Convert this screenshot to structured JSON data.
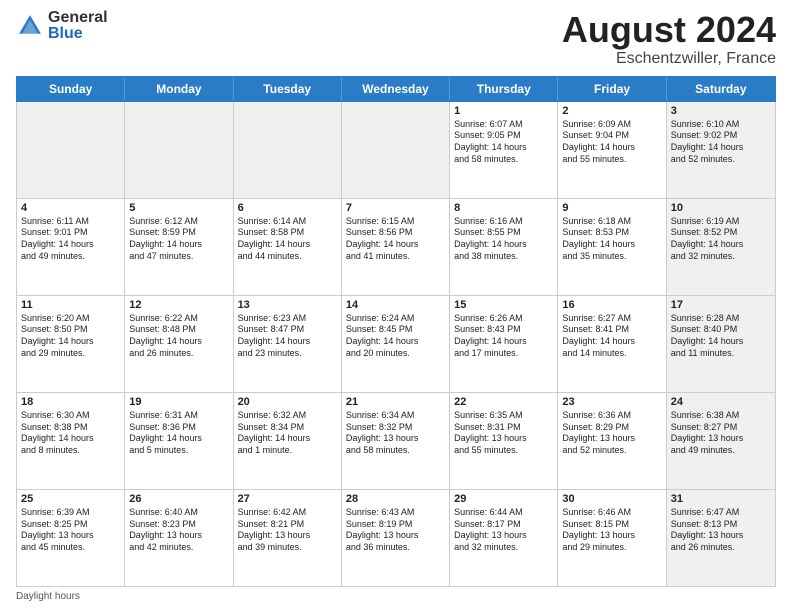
{
  "header": {
    "logo_general": "General",
    "logo_blue": "Blue",
    "title": "August 2024",
    "location": "Eschentzwiller, France"
  },
  "days_of_week": [
    "Sunday",
    "Monday",
    "Tuesday",
    "Wednesday",
    "Thursday",
    "Friday",
    "Saturday"
  ],
  "weeks": [
    [
      {
        "day": "",
        "info": "",
        "shaded": true
      },
      {
        "day": "",
        "info": "",
        "shaded": true
      },
      {
        "day": "",
        "info": "",
        "shaded": true
      },
      {
        "day": "",
        "info": "",
        "shaded": true
      },
      {
        "day": "1",
        "info": "Sunrise: 6:07 AM\nSunset: 9:05 PM\nDaylight: 14 hours\nand 58 minutes.",
        "shaded": false
      },
      {
        "day": "2",
        "info": "Sunrise: 6:09 AM\nSunset: 9:04 PM\nDaylight: 14 hours\nand 55 minutes.",
        "shaded": false
      },
      {
        "day": "3",
        "info": "Sunrise: 6:10 AM\nSunset: 9:02 PM\nDaylight: 14 hours\nand 52 minutes.",
        "shaded": true
      }
    ],
    [
      {
        "day": "4",
        "info": "Sunrise: 6:11 AM\nSunset: 9:01 PM\nDaylight: 14 hours\nand 49 minutes.",
        "shaded": false
      },
      {
        "day": "5",
        "info": "Sunrise: 6:12 AM\nSunset: 8:59 PM\nDaylight: 14 hours\nand 47 minutes.",
        "shaded": false
      },
      {
        "day": "6",
        "info": "Sunrise: 6:14 AM\nSunset: 8:58 PM\nDaylight: 14 hours\nand 44 minutes.",
        "shaded": false
      },
      {
        "day": "7",
        "info": "Sunrise: 6:15 AM\nSunset: 8:56 PM\nDaylight: 14 hours\nand 41 minutes.",
        "shaded": false
      },
      {
        "day": "8",
        "info": "Sunrise: 6:16 AM\nSunset: 8:55 PM\nDaylight: 14 hours\nand 38 minutes.",
        "shaded": false
      },
      {
        "day": "9",
        "info": "Sunrise: 6:18 AM\nSunset: 8:53 PM\nDaylight: 14 hours\nand 35 minutes.",
        "shaded": false
      },
      {
        "day": "10",
        "info": "Sunrise: 6:19 AM\nSunset: 8:52 PM\nDaylight: 14 hours\nand 32 minutes.",
        "shaded": true
      }
    ],
    [
      {
        "day": "11",
        "info": "Sunrise: 6:20 AM\nSunset: 8:50 PM\nDaylight: 14 hours\nand 29 minutes.",
        "shaded": false
      },
      {
        "day": "12",
        "info": "Sunrise: 6:22 AM\nSunset: 8:48 PM\nDaylight: 14 hours\nand 26 minutes.",
        "shaded": false
      },
      {
        "day": "13",
        "info": "Sunrise: 6:23 AM\nSunset: 8:47 PM\nDaylight: 14 hours\nand 23 minutes.",
        "shaded": false
      },
      {
        "day": "14",
        "info": "Sunrise: 6:24 AM\nSunset: 8:45 PM\nDaylight: 14 hours\nand 20 minutes.",
        "shaded": false
      },
      {
        "day": "15",
        "info": "Sunrise: 6:26 AM\nSunset: 8:43 PM\nDaylight: 14 hours\nand 17 minutes.",
        "shaded": false
      },
      {
        "day": "16",
        "info": "Sunrise: 6:27 AM\nSunset: 8:41 PM\nDaylight: 14 hours\nand 14 minutes.",
        "shaded": false
      },
      {
        "day": "17",
        "info": "Sunrise: 6:28 AM\nSunset: 8:40 PM\nDaylight: 14 hours\nand 11 minutes.",
        "shaded": true
      }
    ],
    [
      {
        "day": "18",
        "info": "Sunrise: 6:30 AM\nSunset: 8:38 PM\nDaylight: 14 hours\nand 8 minutes.",
        "shaded": false
      },
      {
        "day": "19",
        "info": "Sunrise: 6:31 AM\nSunset: 8:36 PM\nDaylight: 14 hours\nand 5 minutes.",
        "shaded": false
      },
      {
        "day": "20",
        "info": "Sunrise: 6:32 AM\nSunset: 8:34 PM\nDaylight: 14 hours\nand 1 minute.",
        "shaded": false
      },
      {
        "day": "21",
        "info": "Sunrise: 6:34 AM\nSunset: 8:32 PM\nDaylight: 13 hours\nand 58 minutes.",
        "shaded": false
      },
      {
        "day": "22",
        "info": "Sunrise: 6:35 AM\nSunset: 8:31 PM\nDaylight: 13 hours\nand 55 minutes.",
        "shaded": false
      },
      {
        "day": "23",
        "info": "Sunrise: 6:36 AM\nSunset: 8:29 PM\nDaylight: 13 hours\nand 52 minutes.",
        "shaded": false
      },
      {
        "day": "24",
        "info": "Sunrise: 6:38 AM\nSunset: 8:27 PM\nDaylight: 13 hours\nand 49 minutes.",
        "shaded": true
      }
    ],
    [
      {
        "day": "25",
        "info": "Sunrise: 6:39 AM\nSunset: 8:25 PM\nDaylight: 13 hours\nand 45 minutes.",
        "shaded": false
      },
      {
        "day": "26",
        "info": "Sunrise: 6:40 AM\nSunset: 8:23 PM\nDaylight: 13 hours\nand 42 minutes.",
        "shaded": false
      },
      {
        "day": "27",
        "info": "Sunrise: 6:42 AM\nSunset: 8:21 PM\nDaylight: 13 hours\nand 39 minutes.",
        "shaded": false
      },
      {
        "day": "28",
        "info": "Sunrise: 6:43 AM\nSunset: 8:19 PM\nDaylight: 13 hours\nand 36 minutes.",
        "shaded": false
      },
      {
        "day": "29",
        "info": "Sunrise: 6:44 AM\nSunset: 8:17 PM\nDaylight: 13 hours\nand 32 minutes.",
        "shaded": false
      },
      {
        "day": "30",
        "info": "Sunrise: 6:46 AM\nSunset: 8:15 PM\nDaylight: 13 hours\nand 29 minutes.",
        "shaded": false
      },
      {
        "day": "31",
        "info": "Sunrise: 6:47 AM\nSunset: 8:13 PM\nDaylight: 13 hours\nand 26 minutes.",
        "shaded": true
      }
    ]
  ],
  "footer": "Daylight hours"
}
